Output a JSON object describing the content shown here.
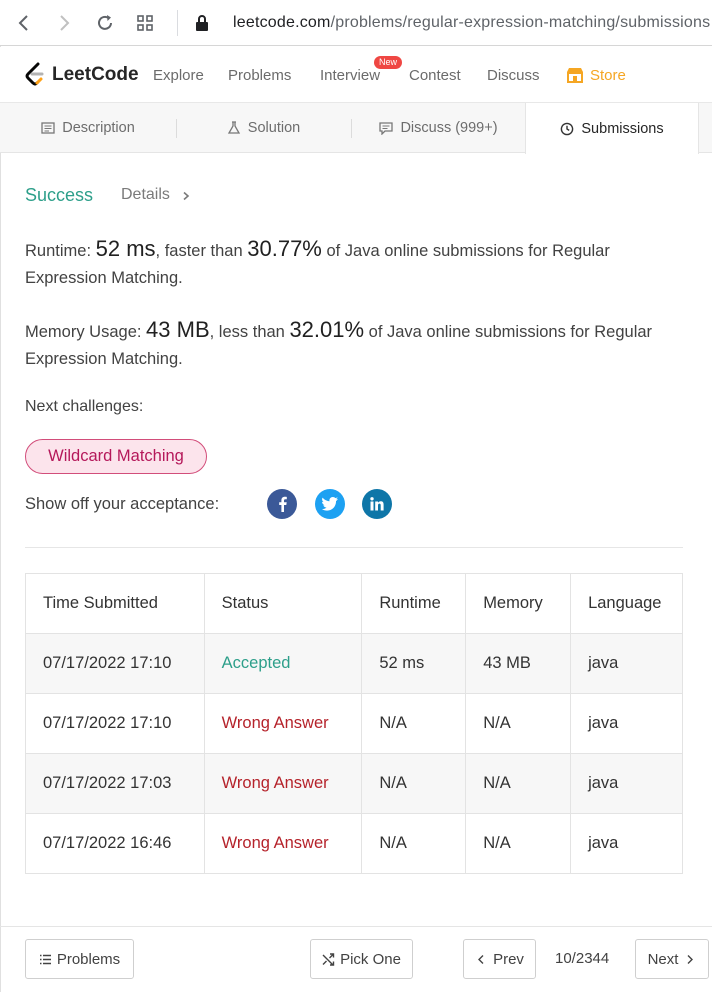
{
  "browser": {
    "url_host": "leetcode.com",
    "url_path": "/problems/regular-expression-matching/submissions"
  },
  "nav": {
    "brand": "LeetCode",
    "links": [
      "Explore",
      "Problems",
      "Interview",
      "Contest",
      "Discuss"
    ],
    "badge": "New",
    "store": "Store"
  },
  "tabs": {
    "description": "Description",
    "solution": "Solution",
    "discuss": "Discuss (999+)",
    "submissions": "Submissions"
  },
  "result": {
    "status": "Success",
    "details": "Details",
    "runtime_label": "Runtime: ",
    "runtime_value": "52 ms",
    "runtime_mid": ", faster than ",
    "runtime_pct": "30.77%",
    "runtime_tail": " of Java online submissions for Regular Expression Matching.",
    "memory_label": "Memory Usage: ",
    "memory_value": "43 MB",
    "memory_mid": ", less than ",
    "memory_pct": "32.01%",
    "memory_tail": " of Java online submissions for Regular Expression Matching.",
    "next_label": "Next challenges:",
    "next_challenge": "Wildcard Matching",
    "show_off": "Show off your acceptance:"
  },
  "table": {
    "headers": [
      "Time Submitted",
      "Status",
      "Runtime",
      "Memory",
      "Language"
    ],
    "rows": [
      {
        "time": "07/17/2022 17:10",
        "status": "Accepted",
        "runtime": "52 ms",
        "memory": "43 MB",
        "language": "java"
      },
      {
        "time": "07/17/2022 17:10",
        "status": "Wrong Answer",
        "runtime": "N/A",
        "memory": "N/A",
        "language": "java"
      },
      {
        "time": "07/17/2022 17:03",
        "status": "Wrong Answer",
        "runtime": "N/A",
        "memory": "N/A",
        "language": "java"
      },
      {
        "time": "07/17/2022 16:46",
        "status": "Wrong Answer",
        "runtime": "N/A",
        "memory": "N/A",
        "language": "java"
      }
    ]
  },
  "footer": {
    "problems": "Problems",
    "pick_one": "Pick One",
    "prev": "Prev",
    "page": "10/2344",
    "next": "Next"
  },
  "colors": {
    "success": "#2d9f8a",
    "wrong": "#b5232b",
    "chip": "#b5185a",
    "store": "#f5a623"
  }
}
